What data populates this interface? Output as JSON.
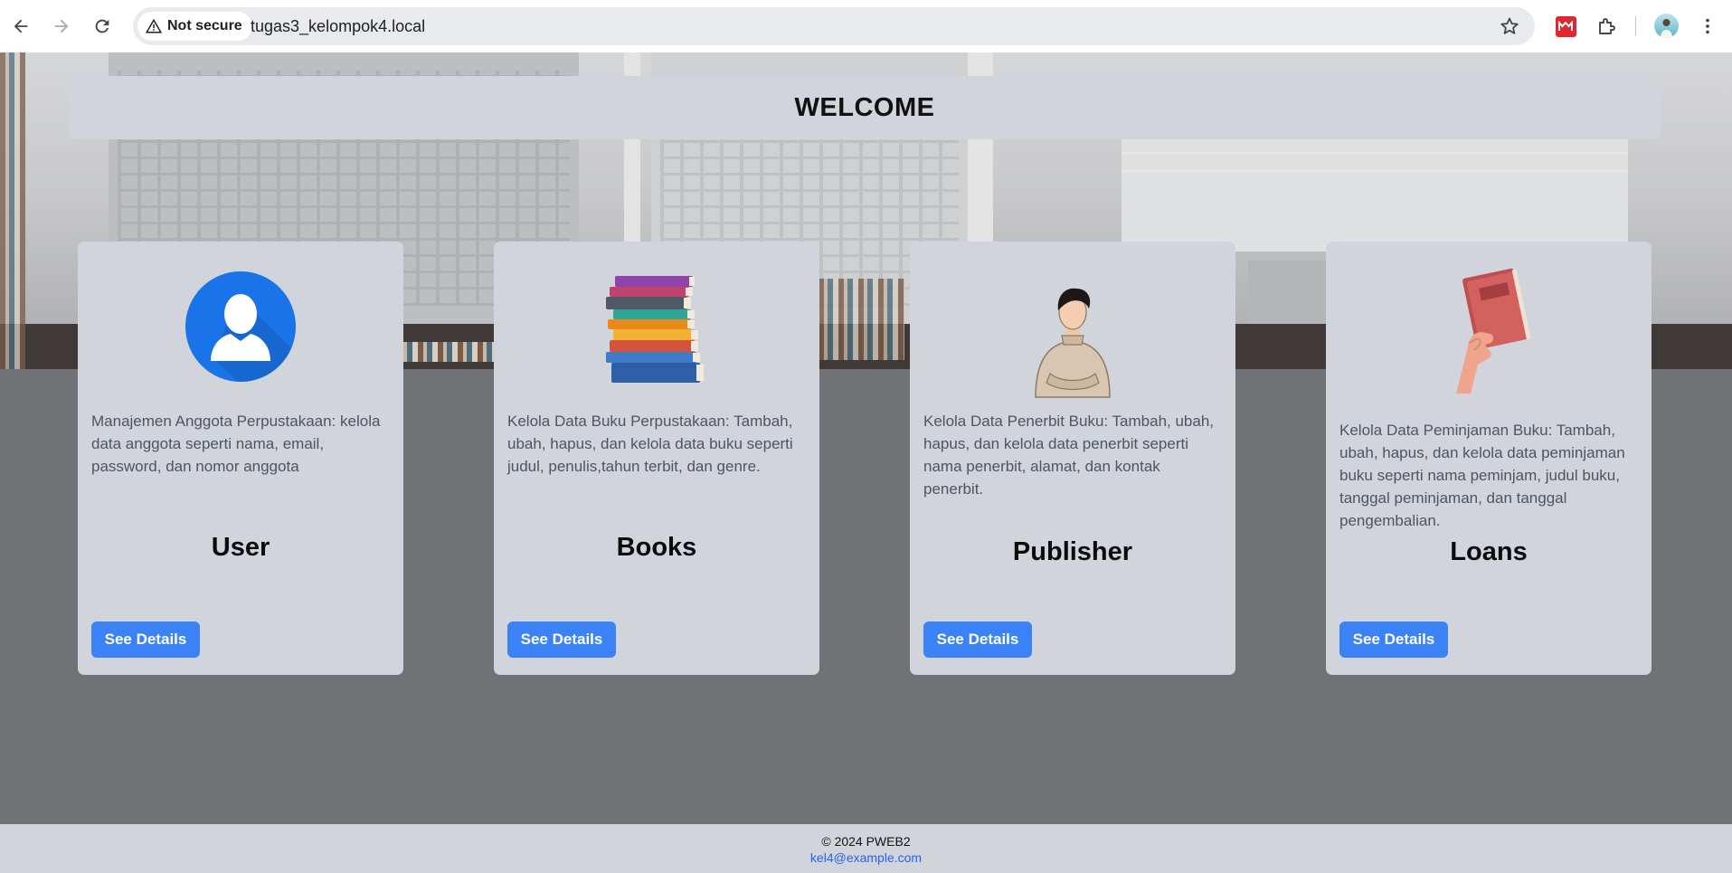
{
  "browser": {
    "security_label": "Not secure",
    "url": "tugas3_kelompok4.local",
    "icons": [
      "back-arrow-icon",
      "forward-arrow-icon",
      "reload-icon",
      "warning-triangle-icon",
      "bookmark-star-icon",
      "extension-red-icon",
      "puzzle-extensions-icon",
      "profile-avatar",
      "kebab-menu-icon"
    ]
  },
  "header": {
    "title": "WELCOME"
  },
  "cards": [
    {
      "title": "User",
      "description": "Manajemen Anggota Perpustakaan: kelola data anggota seperti nama, email, password, dan nomor anggota",
      "button": "See Details",
      "icon": "user-silhouette-icon"
    },
    {
      "title": "Books",
      "description": "Kelola Data Buku Perpustakaan: Tambah, ubah, hapus, dan kelola data buku seperti judul, penulis,tahun terbit, dan genre.",
      "button": "See Details",
      "icon": "book-stack-illustration"
    },
    {
      "title": "Publisher",
      "description": "Kelola Data Penerbit Buku: Tambah, ubah, hapus, dan kelola data penerbit seperti nama penerbit, alamat, dan kontak penerbit.",
      "button": "See Details",
      "icon": "person-illustration"
    },
    {
      "title": "Loans",
      "description": "Kelola Data Peminjaman Buku: Tambah, ubah, hapus, dan kelola data peminjaman buku seperti nama peminjam, judul buku, tanggal peminjaman, dan tanggal pengembalian.",
      "button": "See Details",
      "icon": "hand-holding-book-illustration"
    }
  ],
  "footer": {
    "copyright": "© 2024 PWEB2",
    "email": "kel4@example.com"
  },
  "colors": {
    "accent": "#3b82f6",
    "panel": "#d1d5db",
    "page_background": "#717275",
    "link": "#2563eb"
  }
}
